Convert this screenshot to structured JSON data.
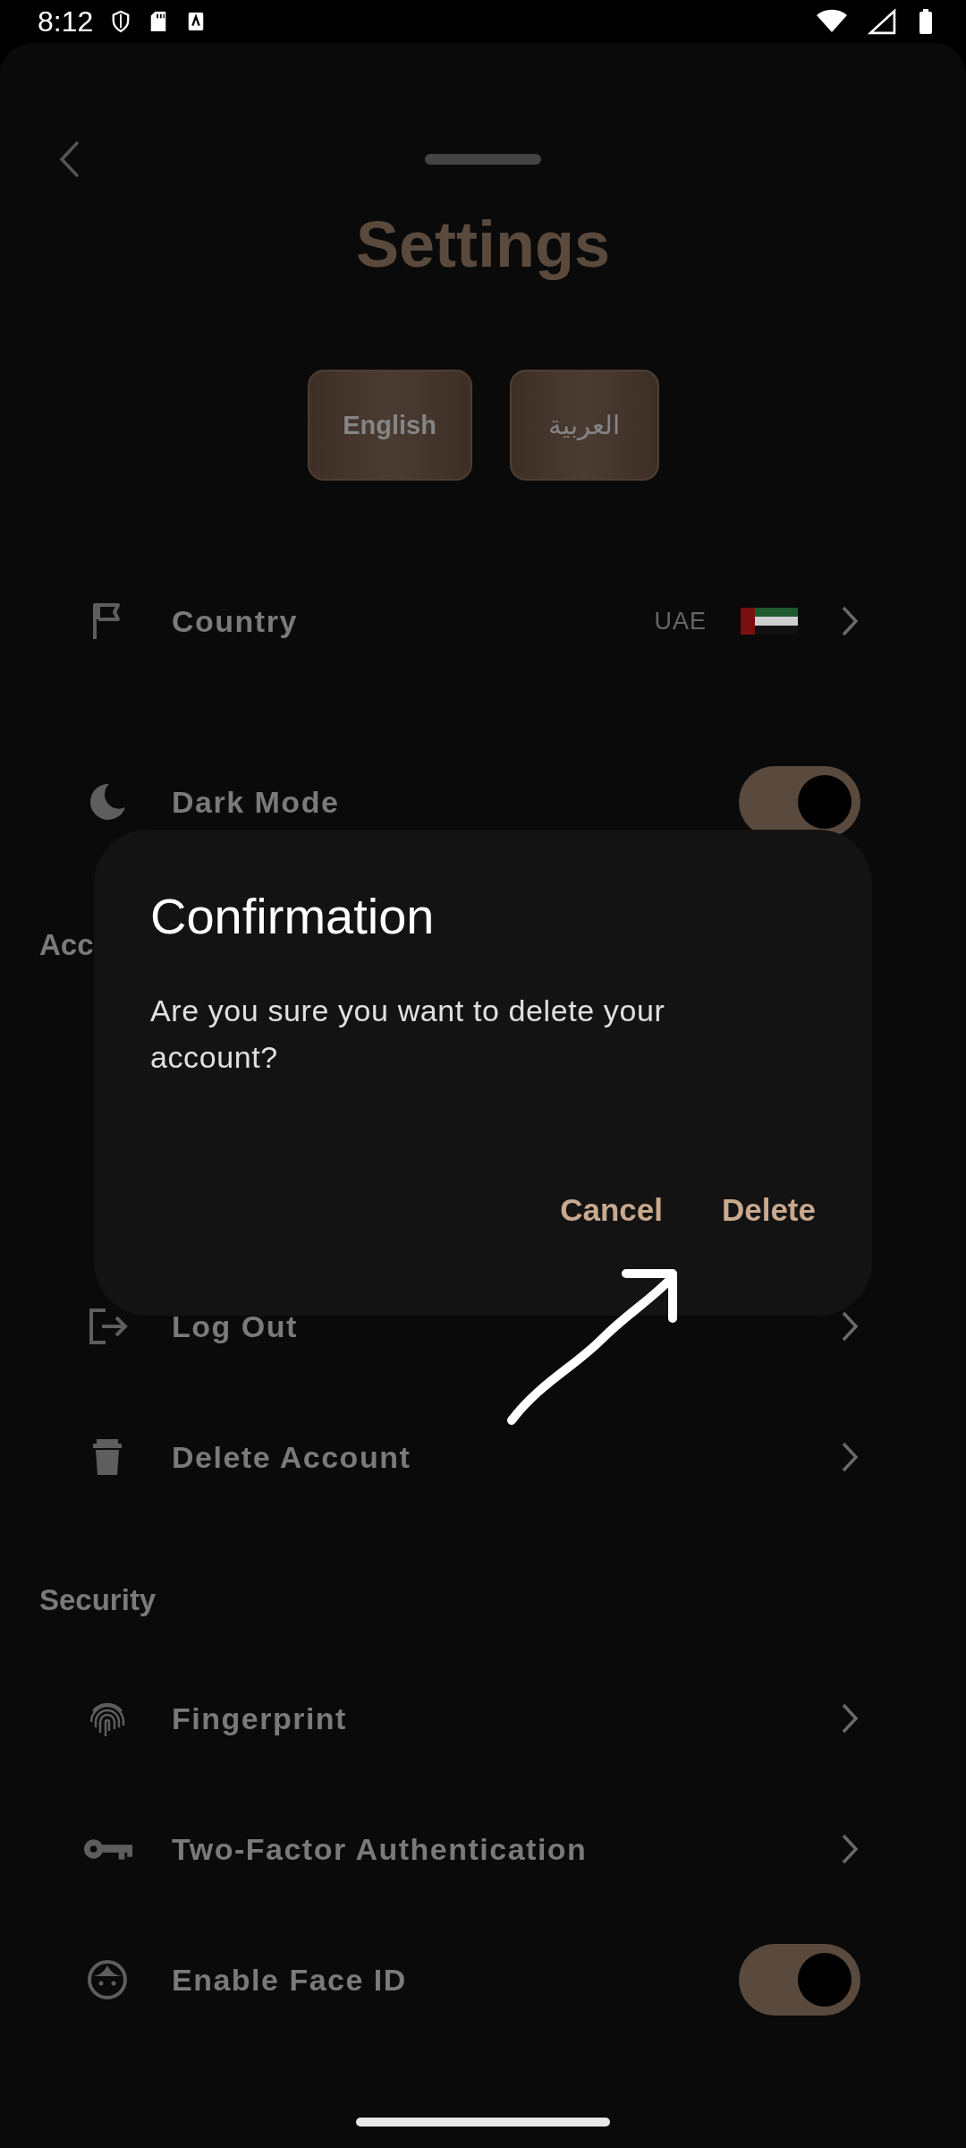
{
  "status_bar": {
    "time": "8:12"
  },
  "header": {
    "title": "Settings"
  },
  "languages": [
    {
      "label": "English"
    },
    {
      "label": "العربية"
    }
  ],
  "general": [
    {
      "kind": "link",
      "label": "Country",
      "value": "UAE"
    },
    {
      "kind": "toggle",
      "label": "Dark Mode",
      "on": true
    }
  ],
  "account": {
    "heading": "Acc",
    "items": [
      {
        "kind": "link",
        "label": "Log Out"
      },
      {
        "kind": "link",
        "label": "Delete Account"
      }
    ]
  },
  "security": {
    "heading": "Security",
    "items": [
      {
        "kind": "link",
        "label": "Fingerprint"
      },
      {
        "kind": "link",
        "label": "Two-Factor Authentication"
      },
      {
        "kind": "toggle",
        "label": "Enable Face ID",
        "on": true
      }
    ]
  },
  "dialog": {
    "title": "Confirmation",
    "message": "Are you sure you want to delete your account?",
    "buttons": [
      "Cancel",
      "Delete"
    ]
  }
}
